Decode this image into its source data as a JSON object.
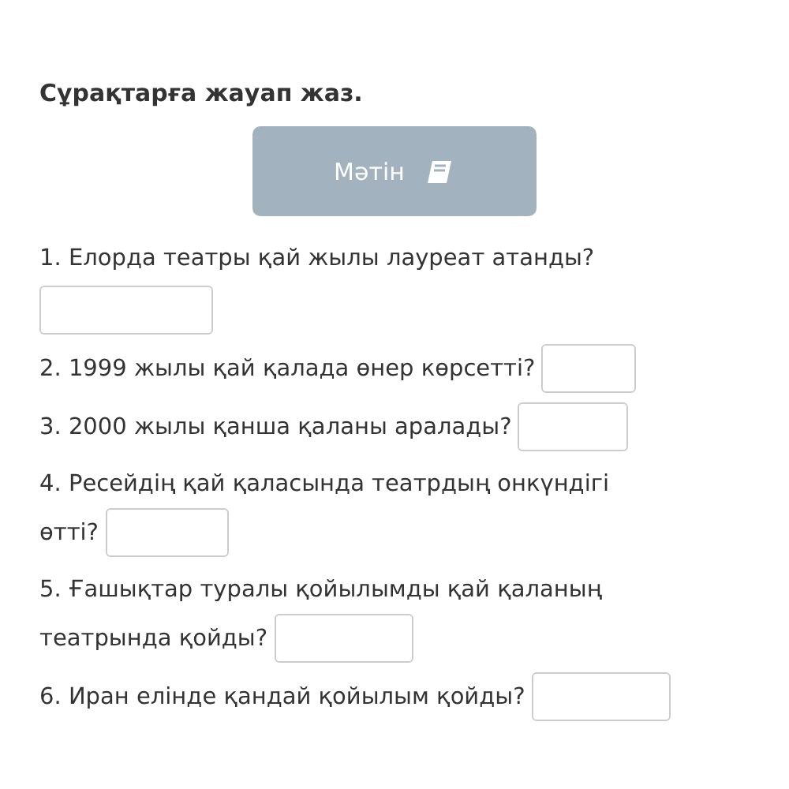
{
  "instruction": "Сұрақтарға жауап жаз.",
  "text_button": {
    "label": "Мәтін"
  },
  "questions": [
    {
      "lines": [
        "1. Елорда театры қай жылы лауреат атанды?"
      ]
    },
    {
      "lines": [
        "2. 1999 жылы қай қалада өнер көрсетті?"
      ]
    },
    {
      "lines": [
        "3. 2000 жылы қанша қаланы аралады?"
      ]
    },
    {
      "lines": [
        "4. Ресейдің қай қаласында театрдың онкүндігі",
        "өтті?"
      ]
    },
    {
      "lines": [
        "5. Ғашықтар туралы қойылымды қай қаланың",
        "театрында қойды?"
      ]
    },
    {
      "lines": [
        "6. Иран елінде қандай қойылым қойды?"
      ]
    }
  ]
}
